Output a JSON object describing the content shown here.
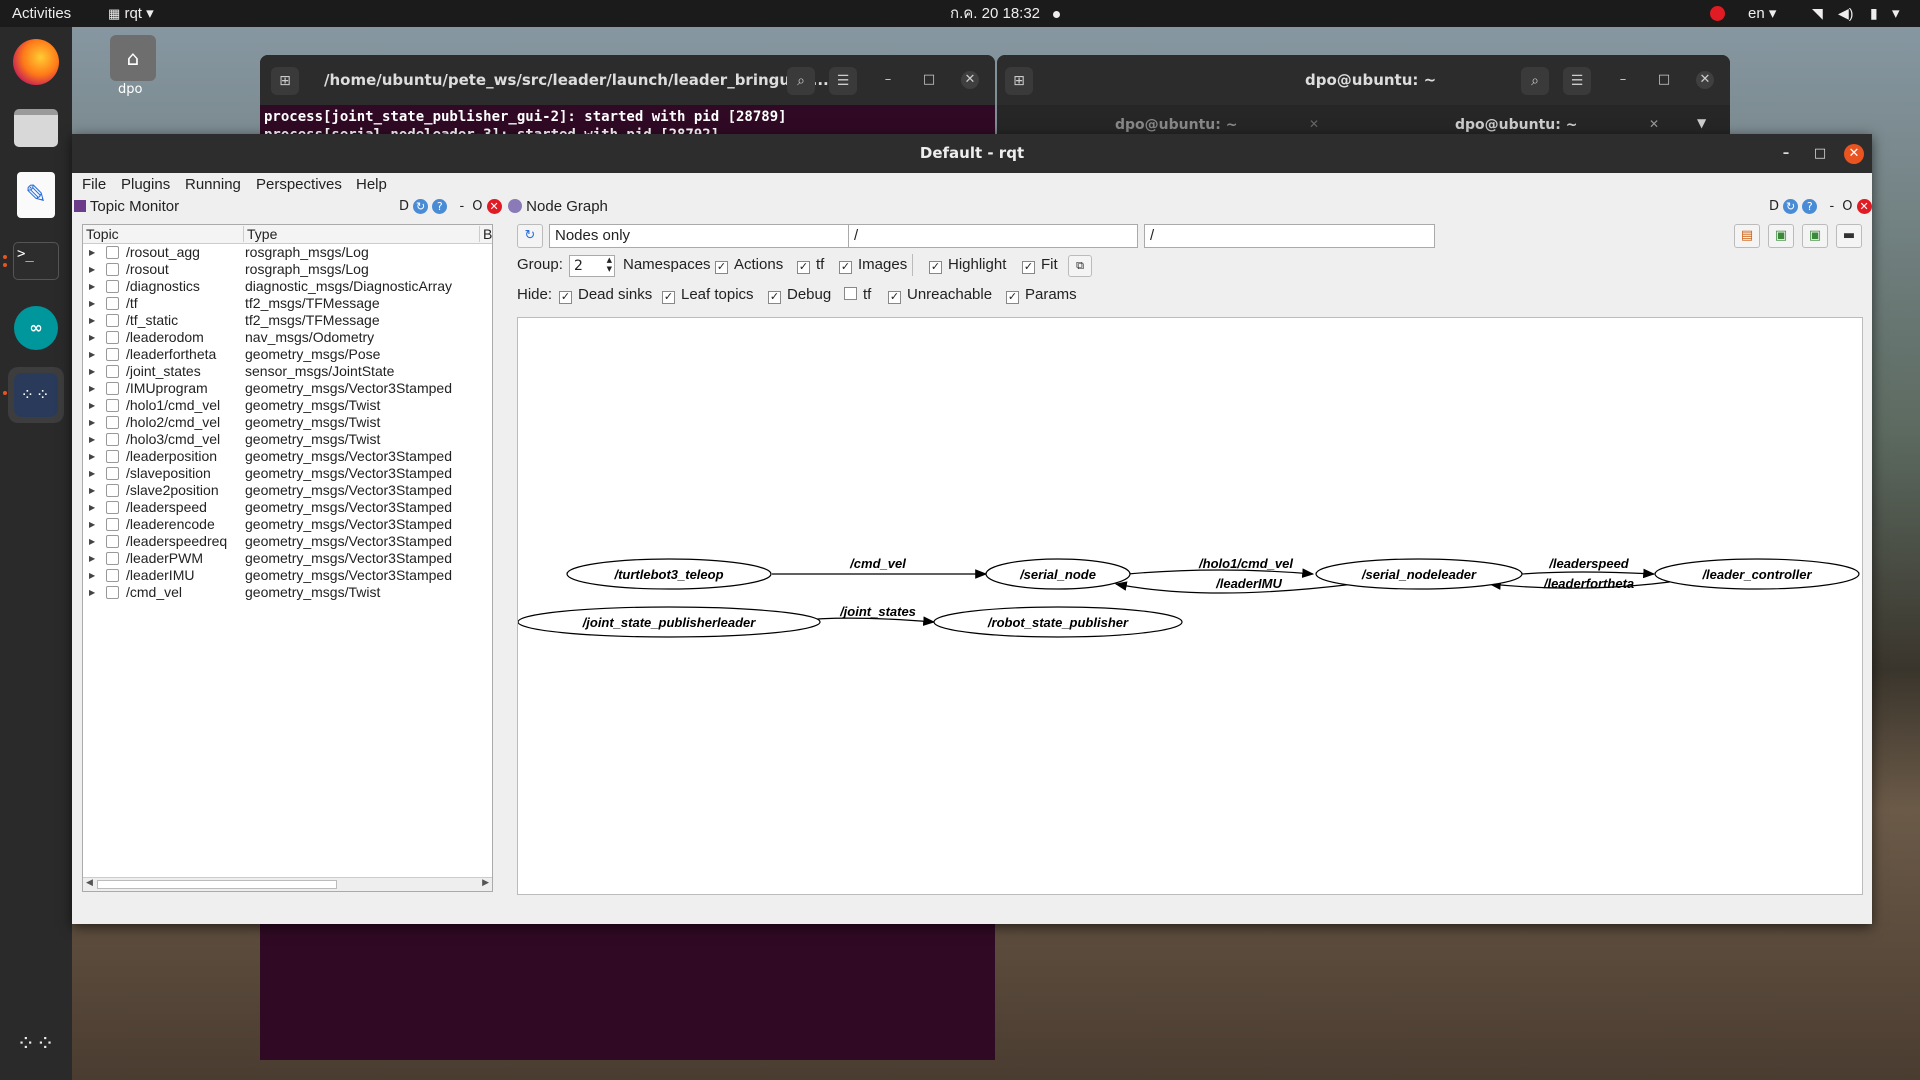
{
  "topbar": {
    "activities": "Activities",
    "app_name": "rqt",
    "app_menu_arrow": "▾",
    "clock": "ก.ค. 20  18:32",
    "language": "en",
    "language_arrow": "▾",
    "status_arrow": "▾"
  },
  "desktop": {
    "home_label": "dpo"
  },
  "terminal_left": {
    "title": "/home/ubuntu/pete_ws/src/leader/launch/leader_bringup.l...",
    "line1": "process[joint_state_publisher_gui-2]: started with pid [28789]",
    "line2": "process[serial_nodeleader-3]: started with pid [28792]"
  },
  "terminal_right": {
    "title": "dpo@ubuntu: ~",
    "tab1": "dpo@ubuntu: ~",
    "tab2": "dpo@ubuntu: ~"
  },
  "rqt": {
    "title": "Default - rqt",
    "menu": [
      "File",
      "Plugins",
      "Running",
      "Perspectives",
      "Help"
    ],
    "topic_monitor": {
      "title": "Topic Monitor",
      "btn_d": "D",
      "btn_dash": "-",
      "btn_o": "O",
      "columns": {
        "topic": "Topic",
        "type": "Type",
        "bandwidth": "Ba"
      },
      "rows": [
        {
          "topic": "/rosout_agg",
          "type": "rosgraph_msgs/Log"
        },
        {
          "topic": "/rosout",
          "type": "rosgraph_msgs/Log"
        },
        {
          "topic": "/diagnostics",
          "type": "diagnostic_msgs/DiagnosticArray"
        },
        {
          "topic": "/tf",
          "type": "tf2_msgs/TFMessage"
        },
        {
          "topic": "/tf_static",
          "type": "tf2_msgs/TFMessage"
        },
        {
          "topic": "/leaderodom",
          "type": "nav_msgs/Odometry"
        },
        {
          "topic": "/leaderfortheta",
          "type": "geometry_msgs/Pose"
        },
        {
          "topic": "/joint_states",
          "type": "sensor_msgs/JointState"
        },
        {
          "topic": "/IMUprogram",
          "type": "geometry_msgs/Vector3Stamped"
        },
        {
          "topic": "/holo1/cmd_vel",
          "type": "geometry_msgs/Twist"
        },
        {
          "topic": "/holo2/cmd_vel",
          "type": "geometry_msgs/Twist"
        },
        {
          "topic": "/holo3/cmd_vel",
          "type": "geometry_msgs/Twist"
        },
        {
          "topic": "/leaderposition",
          "type": "geometry_msgs/Vector3Stamped"
        },
        {
          "topic": "/slaveposition",
          "type": "geometry_msgs/Vector3Stamped"
        },
        {
          "topic": "/slave2position",
          "type": "geometry_msgs/Vector3Stamped"
        },
        {
          "topic": "/leaderspeed",
          "type": "geometry_msgs/Vector3Stamped"
        },
        {
          "topic": "/leaderencode",
          "type": "geometry_msgs/Vector3Stamped"
        },
        {
          "topic": "/leaderspeedreq",
          "type": "geometry_msgs/Vector3Stamped"
        },
        {
          "topic": "/leaderPWM",
          "type": "geometry_msgs/Vector3Stamped"
        },
        {
          "topic": "/leaderIMU",
          "type": "geometry_msgs/Vector3Stamped"
        },
        {
          "topic": "/cmd_vel",
          "type": "geometry_msgs/Twist"
        }
      ]
    },
    "node_graph": {
      "title": "Node Graph",
      "btn_d": "D",
      "btn_dash": "-",
      "btn_o": "O",
      "mode": "Nodes only",
      "filter1": "/",
      "filter2": "/",
      "group_label": "Group:",
      "group_value": "2",
      "options": {
        "namespaces": "Namespaces",
        "actions": "Actions",
        "tf": "tf",
        "images": "Images",
        "highlight": "Highlight",
        "fit": "Fit"
      },
      "hide_label": "Hide:",
      "hide": {
        "dead_sinks": "Dead sinks",
        "leaf_topics": "Leaf topics",
        "debug": "Debug",
        "tf": "tf",
        "unreachable": "Unreachable",
        "params": "Params"
      },
      "graph": {
        "nodes": {
          "teleop": "/turtlebot3_teleop",
          "serial_node": "/serial_node",
          "serial_nodeleader": "/serial_nodeleader",
          "leader_controller": "/leader_controller",
          "jsp_leader": "/joint_state_publisherleader",
          "rsp": "/robot_state_publisher"
        },
        "edges": {
          "cmd_vel": "/cmd_vel",
          "holo1": "/holo1/cmd_vel",
          "leaderIMU": "/leaderIMU",
          "leaderspeed": "/leaderspeed",
          "leaderfortheta": "/leaderfortheta",
          "joint_states": "/joint_states"
        }
      }
    }
  }
}
